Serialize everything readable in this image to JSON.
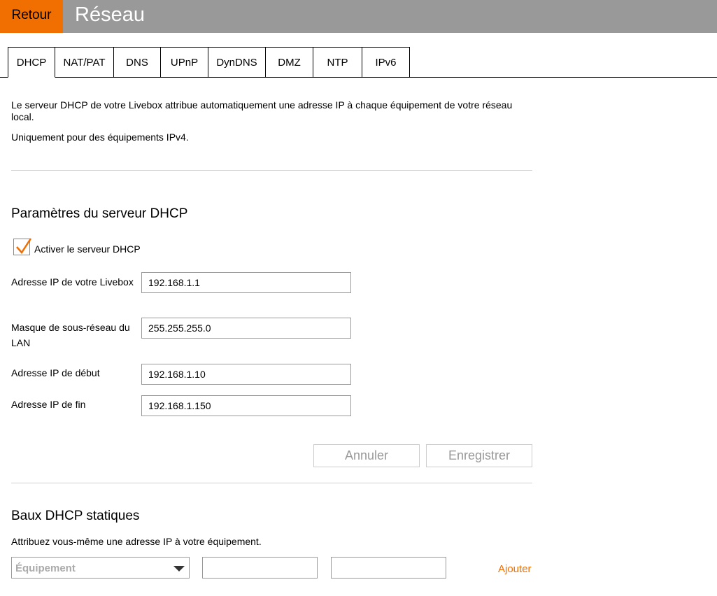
{
  "header": {
    "back_label": "Retour",
    "title": "Réseau"
  },
  "tabs": [
    {
      "label": "DHCP",
      "active": true
    },
    {
      "label": "NAT/PAT"
    },
    {
      "label": "DNS"
    },
    {
      "label": "UPnP"
    },
    {
      "label": "DynDNS"
    },
    {
      "label": "DMZ"
    },
    {
      "label": "NTP"
    },
    {
      "label": "IPv6"
    }
  ],
  "intro": {
    "line1": "Le serveur DHCP de votre Livebox attribue automatiquement une adresse IP à chaque équipement de votre réseau local.",
    "line2": "Uniquement pour des équipements IPv4."
  },
  "dhcp_settings": {
    "title": "Paramètres du serveur DHCP",
    "enable_label": "Activer le serveur DHCP",
    "enabled": true,
    "fields": [
      {
        "label": "Adresse IP de votre Livebox",
        "value": "192.168.1.1"
      },
      {
        "label": "Masque de sous-réseau du LAN",
        "value": "255.255.255.0"
      },
      {
        "label": "Adresse IP de début",
        "value": "192.168.1.10"
      },
      {
        "label": "Adresse IP de fin",
        "value": "192.168.1.150"
      }
    ],
    "cancel_label": "Annuler",
    "save_label": "Enregistrer"
  },
  "static_leases": {
    "title": "Baux DHCP statiques",
    "description": "Attribuez vous-même une adresse IP à votre équipement.",
    "device_placeholder": "Équipement",
    "add_label": "Ajouter"
  },
  "colors": {
    "accent": "#f16e00",
    "header_bg": "#999999"
  }
}
